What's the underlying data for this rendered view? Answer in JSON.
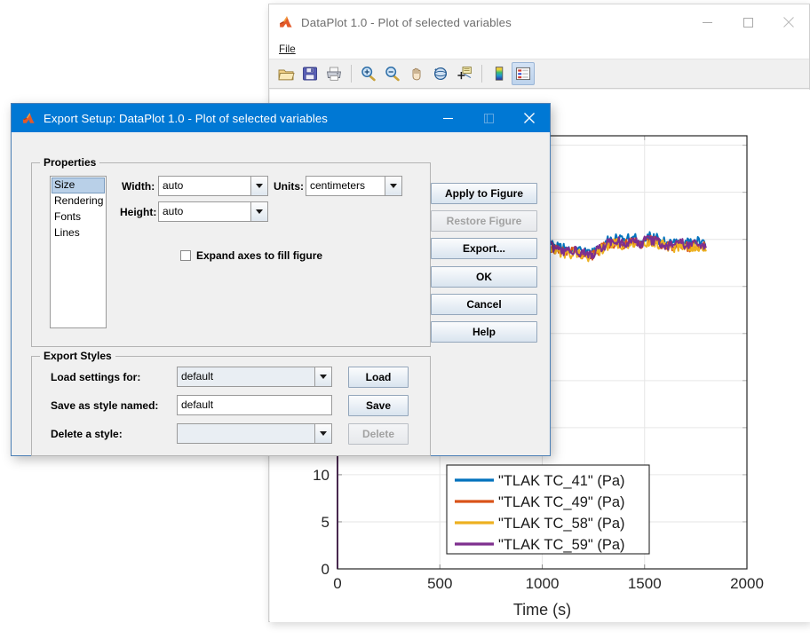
{
  "figure_window": {
    "title": "DataPlot 1.0 - Plot of selected variables",
    "app_icon": "matlab-icon",
    "window_buttons": [
      {
        "name": "minimize-button",
        "glyph": "minimize-icon"
      },
      {
        "name": "maximize-button",
        "glyph": "maximize-icon"
      },
      {
        "name": "close-button",
        "glyph": "close-icon"
      }
    ],
    "menubar": [
      {
        "label": "File",
        "mnemonic": "F"
      }
    ],
    "toolbar": [
      {
        "name": "open-file-button",
        "icon": "open-folder-icon",
        "pressed": false
      },
      {
        "name": "save-figure-button",
        "icon": "save-floppy-icon",
        "pressed": false
      },
      {
        "name": "print-figure-button",
        "icon": "printer-icon",
        "pressed": false
      },
      {
        "name": "zoom-in-button",
        "icon": "zoom-in-icon",
        "pressed": false
      },
      {
        "name": "zoom-out-button",
        "icon": "zoom-out-icon",
        "pressed": false
      },
      {
        "name": "pan-button",
        "icon": "pan-hand-icon",
        "pressed": false
      },
      {
        "name": "rotate-3d-button",
        "icon": "rotate-3d-icon",
        "pressed": false
      },
      {
        "name": "data-cursor-button",
        "icon": "data-cursor-icon",
        "pressed": false
      },
      {
        "name": "insert-colorbar-button",
        "icon": "colorbar-icon",
        "pressed": false
      },
      {
        "name": "insert-legend-button",
        "icon": "legend-icon",
        "pressed": true
      }
    ]
  },
  "chart_data": {
    "type": "line",
    "title": "",
    "xlabel": "Time (s)",
    "ylabel": "",
    "xlim": [
      0,
      2000
    ],
    "ylim": [
      0,
      46
    ],
    "xticks": [
      0,
      500,
      1000,
      1500,
      2000
    ],
    "xticklabels": [
      "0",
      "500",
      "1000",
      "1500",
      "2000"
    ],
    "yticks_visible": [
      0,
      5,
      10
    ],
    "yticklabels_visible": [
      "0",
      "5",
      "10"
    ],
    "ytick_step": 5,
    "grid": true,
    "legend_position": "south-center-inside",
    "legend_entries": [
      {
        "label": "\"TLAK TC_41\" (Pa)",
        "color": "#0072BD"
      },
      {
        "label": "\"TLAK TC_49\" (Pa)",
        "color": "#D95319"
      },
      {
        "label": "\"TLAK TC_58\" (Pa)",
        "color": "#EDB120"
      },
      {
        "label": "\"TLAK TC_59\" (Pa)",
        "color": "#7E2F8E"
      }
    ],
    "series": [
      {
        "name": "\"TLAK TC_41\" (Pa)",
        "color": "#0072BD",
        "x": [
          0,
          40,
          80,
          120,
          160,
          200,
          240,
          280,
          320,
          360,
          400,
          440,
          480,
          520,
          560,
          600,
          640,
          680,
          720,
          760,
          800,
          840,
          880,
          920,
          960,
          1000,
          1040,
          1080,
          1120,
          1160,
          1200,
          1240,
          1280,
          1320,
          1360,
          1400,
          1440,
          1480,
          1520,
          1560,
          1600,
          1640,
          1680,
          1720,
          1760,
          1800
        ],
        "y": [
          33.3,
          33.5,
          33.9,
          34.1,
          34.0,
          34.3,
          34.1,
          34.4,
          34.2,
          34.5,
          34.3,
          34.6,
          34.4,
          34.7,
          34.5,
          34.8,
          34.6,
          34.9,
          34.7,
          35.0,
          34.8,
          35.1,
          34.9,
          35.2,
          35.0,
          34.9,
          34.6,
          34.2,
          33.9,
          34.1,
          33.8,
          33.5,
          34.2,
          34.8,
          35.1,
          34.9,
          35.2,
          34.9,
          35.3,
          35.1,
          34.8,
          34.5,
          34.9,
          34.6,
          34.8,
          34.7
        ]
      },
      {
        "name": "\"TLAK TC_49\" (Pa)",
        "color": "#D95319",
        "x": [
          0,
          40,
          80,
          120,
          160,
          200,
          240,
          280,
          320,
          360,
          400,
          440,
          480,
          520,
          560,
          600,
          640,
          680,
          720,
          760,
          800,
          840,
          880,
          920,
          960,
          1000,
          1040,
          1080,
          1120,
          1160,
          1200,
          1240,
          1280,
          1320,
          1360,
          1400,
          1440,
          1480,
          1520,
          1560,
          1600,
          1640,
          1680,
          1720,
          1760,
          1800
        ],
        "y": [
          32.9,
          33.1,
          33.4,
          33.7,
          33.5,
          33.9,
          33.7,
          34.0,
          33.8,
          34.1,
          33.9,
          34.2,
          34.0,
          34.3,
          34.1,
          34.4,
          34.2,
          34.5,
          34.3,
          34.6,
          34.4,
          34.7,
          34.5,
          34.8,
          34.6,
          34.5,
          34.2,
          33.8,
          33.5,
          33.7,
          33.4,
          33.2,
          33.9,
          34.4,
          34.7,
          34.5,
          34.8,
          34.5,
          34.9,
          34.7,
          34.4,
          34.1,
          34.5,
          34.2,
          34.4,
          34.3
        ]
      },
      {
        "name": "\"TLAK TC_58\" (Pa)",
        "color": "#EDB120",
        "x": [
          0,
          40,
          80,
          120,
          160,
          200,
          240,
          280,
          320,
          360,
          400,
          440,
          480,
          520,
          560,
          600,
          640,
          680,
          720,
          760,
          800,
          840,
          880,
          920,
          960,
          1000,
          1040,
          1080,
          1120,
          1160,
          1200,
          1240,
          1280,
          1320,
          1360,
          1400,
          1440,
          1480,
          1520,
          1560,
          1600,
          1640,
          1680,
          1720,
          1760,
          1800
        ],
        "y": [
          32.7,
          33.0,
          33.2,
          33.5,
          33.4,
          33.7,
          33.5,
          33.9,
          33.7,
          34.0,
          33.8,
          34.1,
          33.9,
          34.2,
          34.0,
          34.3,
          34.1,
          34.4,
          34.2,
          34.5,
          34.3,
          34.6,
          34.4,
          34.7,
          34.5,
          34.4,
          34.1,
          33.7,
          33.4,
          33.6,
          33.3,
          33.1,
          33.8,
          34.3,
          34.6,
          34.4,
          34.7,
          34.4,
          34.8,
          34.6,
          34.3,
          34.0,
          34.4,
          34.1,
          34.3,
          34.2
        ]
      },
      {
        "name": "\"TLAK TC_59\" (Pa)",
        "color": "#7E2F8E",
        "x": [
          0,
          0,
          40,
          80,
          120,
          160,
          200,
          240,
          280,
          320,
          360,
          400,
          440,
          480,
          520,
          560,
          600,
          640,
          680,
          720,
          760,
          800,
          840,
          880,
          920,
          960,
          1000,
          1040,
          1080,
          1120,
          1160,
          1200,
          1240,
          1280,
          1320,
          1360,
          1400,
          1440,
          1480,
          1520,
          1560,
          1600,
          1640,
          1680,
          1720,
          1760,
          1800
        ],
        "y": [
          0,
          33.0,
          33.2,
          33.6,
          33.8,
          33.7,
          34.0,
          33.8,
          34.1,
          33.9,
          34.2,
          34.0,
          34.3,
          34.1,
          34.4,
          34.2,
          34.5,
          34.3,
          34.6,
          34.4,
          34.7,
          34.5,
          34.8,
          34.6,
          34.9,
          34.7,
          34.6,
          34.3,
          33.9,
          33.6,
          33.8,
          33.5,
          33.3,
          34.0,
          34.5,
          34.8,
          34.6,
          34.9,
          34.6,
          35.0,
          34.8,
          34.5,
          34.2,
          34.6,
          34.3,
          34.5,
          34.4
        ]
      }
    ]
  },
  "export_dialog": {
    "title": "Export Setup: DataPlot 1.0 - Plot of selected variables",
    "app_icon": "matlab-icon",
    "window_buttons": [
      {
        "name": "minimize-button",
        "glyph": "minimize-icon",
        "disabled": false
      },
      {
        "name": "maximize-button",
        "glyph": "maximize-icon",
        "disabled": true
      },
      {
        "name": "close-button",
        "glyph": "close-icon",
        "disabled": false
      }
    ],
    "properties_group": {
      "legend": "Properties",
      "list_items": [
        {
          "label": "Size",
          "selected": true
        },
        {
          "label": "Rendering",
          "selected": false
        },
        {
          "label": "Fonts",
          "selected": false
        },
        {
          "label": "Lines",
          "selected": false
        }
      ],
      "width_label": "Width:",
      "width_value": "auto",
      "height_label": "Height:",
      "height_value": "auto",
      "units_label": "Units:",
      "units_value": "centimeters",
      "expand_checkbox_label": "Expand axes to fill figure",
      "expand_checked": false
    },
    "styles_group": {
      "legend": "Export Styles",
      "load_label": "Load settings for:",
      "load_value": "default",
      "load_button": "Load",
      "save_label": "Save as style named:",
      "save_value": "default",
      "save_button": "Save",
      "delete_label": "Delete a style:",
      "delete_value": "",
      "delete_button": "Delete",
      "delete_button_disabled": true
    },
    "action_buttons": [
      {
        "label": "Apply to Figure",
        "name": "apply-to-figure-button",
        "disabled": false
      },
      {
        "label": "Restore Figure",
        "name": "restore-figure-button",
        "disabled": true
      },
      {
        "label": "Export...",
        "name": "export-button",
        "disabled": false
      },
      {
        "label": "OK",
        "name": "ok-button",
        "disabled": false
      },
      {
        "label": "Cancel",
        "name": "cancel-button",
        "disabled": false
      },
      {
        "label": "Help",
        "name": "help-button",
        "disabled": false
      }
    ]
  },
  "colors": {
    "titlebar_active": "#0078d4",
    "dialog_bg": "#f0f0f0",
    "series1": "#0072BD",
    "series2": "#D95319",
    "series3": "#EDB120",
    "series4": "#7E2F8E"
  }
}
